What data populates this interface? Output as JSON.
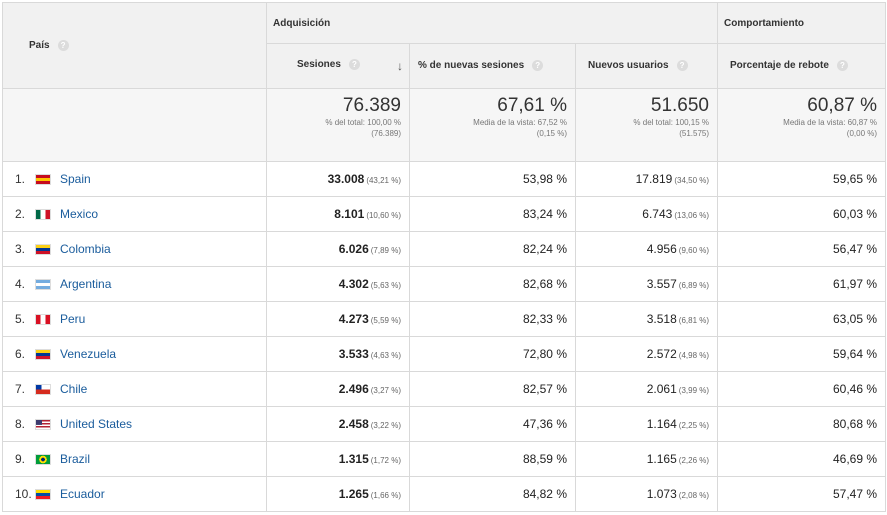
{
  "header": {
    "pais_label": "País",
    "group_adquisicion": "Adquisición",
    "group_comportamiento": "Comportamiento",
    "columns": {
      "sesiones": "Sesiones",
      "nuevas_sesiones": "% de nuevas sesiones",
      "nuevos_usuarios": "Nuevos usuarios",
      "rebote": "Porcentaje de rebote"
    },
    "help_glyph": "?",
    "sort_glyph": "↓"
  },
  "totals": {
    "sesiones": {
      "value": "76.389",
      "line1": "% del total: 100,00 %",
      "line2": "(76.389)"
    },
    "nuevas_sesiones": {
      "value": "67,61 %",
      "line1": "Media de la vista: 67,52 %",
      "line2": "(0,15 %)"
    },
    "nuevos_usuarios": {
      "value": "51.650",
      "line1": "% del total: 100,15 %",
      "line2": "(51.575)"
    },
    "rebote": {
      "value": "60,87 %",
      "line1": "Media de la vista: 60,87 %",
      "line2": "(0,00 %)"
    }
  },
  "rows": [
    {
      "index": "1.",
      "country": "Spain",
      "flag_colors": [
        "#c60b1e",
        "#ffc400",
        "#c60b1e"
      ],
      "flag_dir": "h",
      "sesiones": "33.008",
      "sesiones_pct": "(43,21 %)",
      "nuevas": "53,98 %",
      "usuarios": "17.819",
      "usuarios_pct": "(34,50 %)",
      "rebote": "59,65 %"
    },
    {
      "index": "2.",
      "country": "Mexico",
      "flag_colors": [
        "#006847",
        "#ffffff",
        "#ce1126"
      ],
      "flag_dir": "v",
      "sesiones": "8.101",
      "sesiones_pct": "(10,60 %)",
      "nuevas": "83,24 %",
      "usuarios": "6.743",
      "usuarios_pct": "(13,06 %)",
      "rebote": "60,03 %"
    },
    {
      "index": "3.",
      "country": "Colombia",
      "flag_colors": [
        "#fcd116",
        "#003893",
        "#ce1126"
      ],
      "flag_dir": "h",
      "sesiones": "6.026",
      "sesiones_pct": "(7,89 %)",
      "nuevas": "82,24 %",
      "usuarios": "4.956",
      "usuarios_pct": "(9,60 %)",
      "rebote": "56,47 %"
    },
    {
      "index": "4.",
      "country": "Argentina",
      "flag_colors": [
        "#74acdf",
        "#ffffff",
        "#74acdf"
      ],
      "flag_dir": "h",
      "sesiones": "4.302",
      "sesiones_pct": "(5,63 %)",
      "nuevas": "82,68 %",
      "usuarios": "3.557",
      "usuarios_pct": "(6,89 %)",
      "rebote": "61,97 %"
    },
    {
      "index": "5.",
      "country": "Peru",
      "flag_colors": [
        "#d91023",
        "#ffffff",
        "#d91023"
      ],
      "flag_dir": "v",
      "sesiones": "4.273",
      "sesiones_pct": "(5,59 %)",
      "nuevas": "82,33 %",
      "usuarios": "3.518",
      "usuarios_pct": "(6,81 %)",
      "rebote": "63,05 %"
    },
    {
      "index": "6.",
      "country": "Venezuela",
      "flag_colors": [
        "#fcd116",
        "#003893",
        "#cf142b"
      ],
      "flag_dir": "h",
      "sesiones": "3.533",
      "sesiones_pct": "(4,63 %)",
      "nuevas": "72,80 %",
      "usuarios": "2.572",
      "usuarios_pct": "(4,98 %)",
      "rebote": "59,64 %"
    },
    {
      "index": "7.",
      "country": "Chile",
      "flag_colors": [
        "#0039a6",
        "#ffffff",
        "#d52b1e"
      ],
      "flag_dir": "cl",
      "sesiones": "2.496",
      "sesiones_pct": "(3,27 %)",
      "nuevas": "82,57 %",
      "usuarios": "2.061",
      "usuarios_pct": "(3,99 %)",
      "rebote": "60,46 %"
    },
    {
      "index": "8.",
      "country": "United States",
      "flag_colors": [
        "#3c3b6e",
        "#ffffff",
        "#b22234"
      ],
      "flag_dir": "us",
      "sesiones": "2.458",
      "sesiones_pct": "(3,22 %)",
      "nuevas": "47,36 %",
      "usuarios": "1.164",
      "usuarios_pct": "(2,25 %)",
      "rebote": "80,68 %"
    },
    {
      "index": "9.",
      "country": "Brazil",
      "flag_colors": [
        "#009c3b",
        "#ffdf00",
        "#002776"
      ],
      "flag_dir": "br",
      "sesiones": "1.315",
      "sesiones_pct": "(1,72 %)",
      "nuevas": "88,59 %",
      "usuarios": "1.165",
      "usuarios_pct": "(2,26 %)",
      "rebote": "46,69 %"
    },
    {
      "index": "10.",
      "country": "Ecuador",
      "flag_colors": [
        "#ffdd00",
        "#034ea2",
        "#ed1c24"
      ],
      "flag_dir": "h",
      "sesiones": "1.265",
      "sesiones_pct": "(1,66 %)",
      "nuevas": "84,82 %",
      "usuarios": "1.073",
      "usuarios_pct": "(2,08 %)",
      "rebote": "57,47 %"
    }
  ]
}
